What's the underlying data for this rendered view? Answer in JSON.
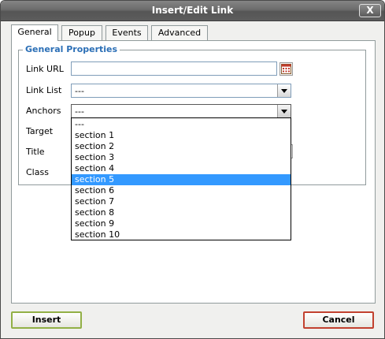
{
  "window": {
    "title": "Insert/Edit Link",
    "close_glyph": "X"
  },
  "tabs": [
    {
      "label": "General",
      "active": true
    },
    {
      "label": "Popup",
      "active": false
    },
    {
      "label": "Events",
      "active": false
    },
    {
      "label": "Advanced",
      "active": false
    }
  ],
  "general": {
    "legend": "General Properties",
    "link_url": {
      "label": "Link URL",
      "value": ""
    },
    "link_list": {
      "label": "Link List",
      "value": "---"
    },
    "anchors": {
      "label": "Anchors",
      "value": "---",
      "options": [
        "---",
        "section 1",
        "section 2",
        "section 3",
        "section 4",
        "section 5",
        "section 6",
        "section 7",
        "section 8",
        "section 9",
        "section 10"
      ],
      "highlighted": "section 5"
    },
    "target": {
      "label": "Target"
    },
    "title": {
      "label": "Title"
    },
    "class": {
      "label": "Class"
    }
  },
  "buttons": {
    "insert": "Insert",
    "cancel": "Cancel"
  },
  "colors": {
    "legend": "#2b6fb6",
    "highlight": "#3399ff",
    "insert_border": "#92b046",
    "cancel_border": "#c2412f"
  },
  "icons": {
    "browse": "browse-file-icon",
    "dropdown": "chevron-down-icon"
  }
}
